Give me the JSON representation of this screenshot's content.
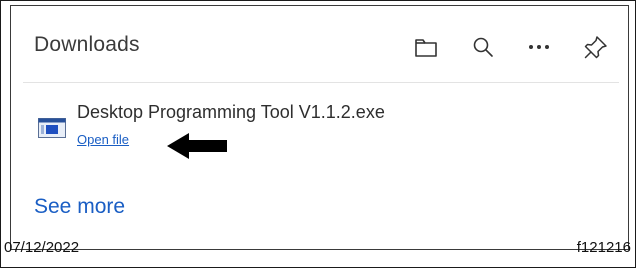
{
  "header": {
    "title": "Downloads",
    "icons": [
      "folder-icon",
      "search-icon",
      "more-icon",
      "pin-icon"
    ]
  },
  "download_item": {
    "file_name": "Desktop Programming Tool V1.1.2.exe",
    "action_label": "Open file",
    "icon": "executable-file-icon"
  },
  "footer": {
    "see_more_label": "See more"
  },
  "caption": {
    "date": "07/12/2022",
    "figure_id": "f121216"
  },
  "colors": {
    "link": "#1a5ec4",
    "text": "#2e2e2e",
    "border": "#3a3a3a"
  }
}
